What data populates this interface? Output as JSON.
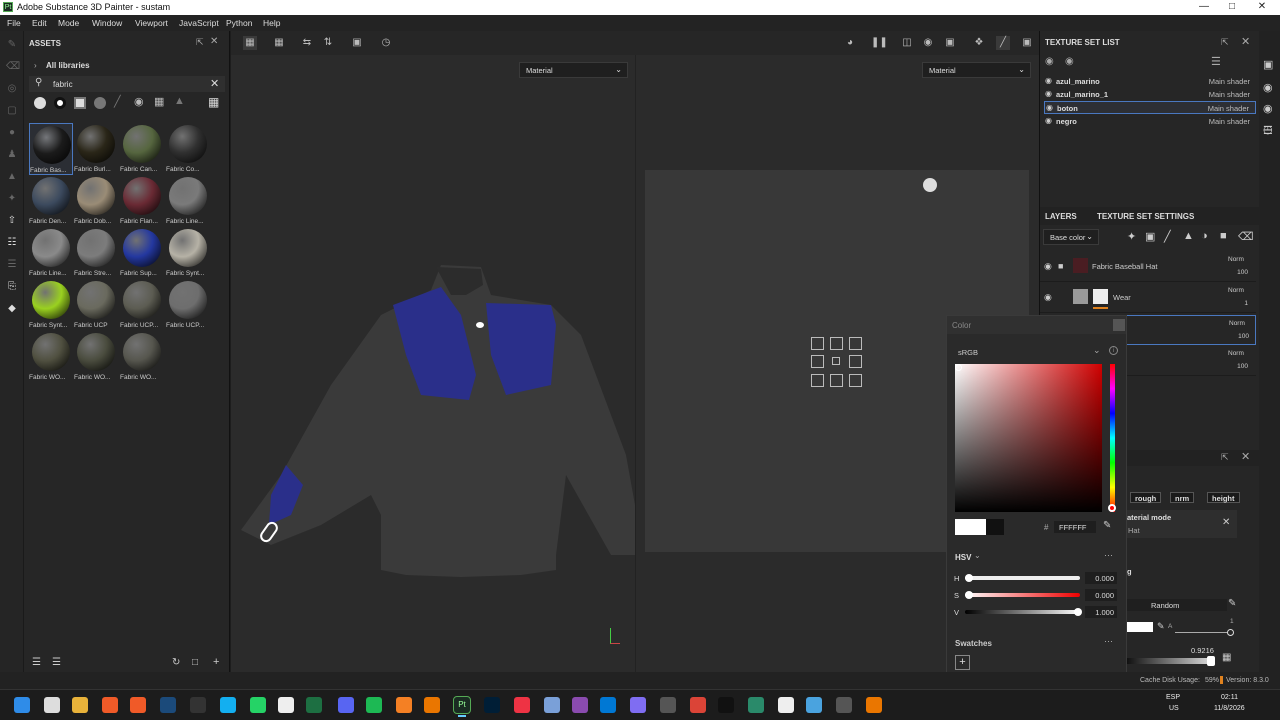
{
  "window": {
    "title": "Adobe Substance 3D Painter - sustam",
    "logo": "Pt"
  },
  "menu": [
    "File",
    "Edit",
    "Mode",
    "Window",
    "Viewport",
    "JavaScript",
    "Python",
    "Help"
  ],
  "assets": {
    "title": "ASSETS",
    "breadcrumb": "All libraries",
    "search_value": "fabric",
    "tiles": [
      {
        "label": "Fabric Bas...",
        "color": "#1b1b1b"
      },
      {
        "label": "Fabric Burl...",
        "color": "#2a2618"
      },
      {
        "label": "Fabric Can...",
        "color": "#56663f"
      },
      {
        "label": "Fabric Co...",
        "color": "#303030"
      },
      {
        "label": "Fabric Den...",
        "color": "#3c4a5e"
      },
      {
        "label": "Fabric Dob...",
        "color": "#9a8c76"
      },
      {
        "label": "Fabric Flan...",
        "color": "#6a2a34"
      },
      {
        "label": "Fabric Line...",
        "color": "#7a7a7a"
      },
      {
        "label": "Fabric Line...",
        "color": "#8a8a8a"
      },
      {
        "label": "Fabric Stre...",
        "color": "#7c7c7c"
      },
      {
        "label": "Fabric Sup...",
        "color": "#2438a0"
      },
      {
        "label": "Fabric Synt...",
        "color": "#b6b2a6"
      },
      {
        "label": "Fabric Synt...",
        "color": "#9ad120"
      },
      {
        "label": "Fabric UCP",
        "color": "#6a6a5e"
      },
      {
        "label": "Fabric UCP...",
        "color": "#5c5c52"
      },
      {
        "label": "Fabric UCP...",
        "color": "#6e6e6e"
      },
      {
        "label": "Fabric WO...",
        "color": "#505040"
      },
      {
        "label": "Fabric WO...",
        "color": "#4a4c3e"
      },
      {
        "label": "Fabric WO...",
        "color": "#56564e"
      }
    ]
  },
  "viewport": {
    "left_mode": "Material",
    "right_mode": "Material"
  },
  "texture_set_list": {
    "title": "TEXTURE SET LIST",
    "items": [
      {
        "name": "azul_marino",
        "shader": "Main shader"
      },
      {
        "name": "azul_marino_1",
        "shader": "Main shader"
      },
      {
        "name": "boton",
        "shader": "Main shader"
      },
      {
        "name": "negro",
        "shader": "Main shader"
      }
    ]
  },
  "layers": {
    "tab_layers": "LAYERS",
    "tab_settings": "TEXTURE SET SETTINGS",
    "channel": "Base color",
    "items": [
      {
        "name": "Fabric Baseball Hat",
        "blend": "Norm",
        "opacity": "100",
        "color": "#4a1d22"
      },
      {
        "name": "Wear",
        "blend": "Norm",
        "opacity": "1",
        "color": "#9a9a9a"
      },
      {
        "name": "",
        "blend": "Norm",
        "opacity": "100",
        "color": "#555"
      },
      {
        "name": "",
        "blend": "Norm",
        "opacity": "100",
        "color": "#555"
      }
    ]
  },
  "properties": {
    "chips": [
      "rough",
      "nrm",
      "height"
    ],
    "mode_label": "aterial mode",
    "mode_sub": "Hat",
    "section": "g",
    "random": "Random",
    "a_label": "A",
    "a_value": "1",
    "value": "0.9216"
  },
  "color_picker": {
    "title": "Color",
    "space": "sRGB",
    "hex_label": "#",
    "hex": "FFFFFF",
    "model": "HSV",
    "h_label": "H",
    "h": "0.000",
    "s_label": "S",
    "s": "0.000",
    "v_label": "V",
    "v": "1.000",
    "swatches": "Swatches"
  },
  "status": {
    "cache": "Cache Disk Usage:",
    "cache_pct": "59%",
    "version": "Version: 8.3.0"
  },
  "taskbar": {
    "lang1": "ESP",
    "lang2": "US",
    "time": "02:11",
    "date": "11/8/2026"
  }
}
